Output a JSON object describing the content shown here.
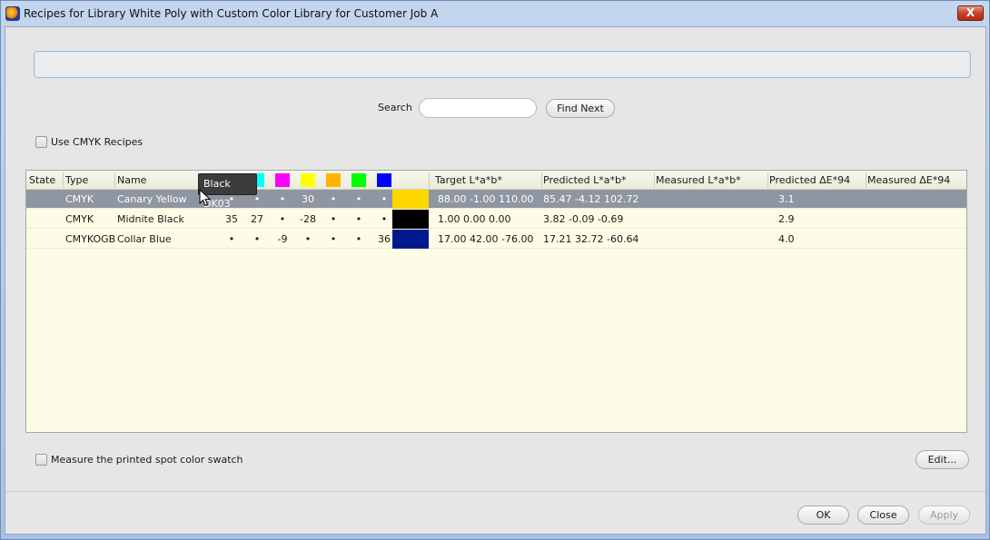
{
  "window": {
    "title": "Recipes for Library White Poly with Custom Color Library for Customer Job A",
    "close_label": "X"
  },
  "search": {
    "label": "Search",
    "value": "",
    "find_next": "Find Next"
  },
  "use_cmyk": {
    "label": "Use CMYK Recipes"
  },
  "table": {
    "headers": [
      "State",
      "Type",
      "Name",
      "Target L*a*b*",
      "Predicted L*a*b*",
      "Measured L*a*b*",
      "Predicted ΔE*94",
      "Measured ΔE*94"
    ],
    "inks": [
      {
        "name": "black-ink",
        "color": "#000000"
      },
      {
        "name": "cyan-ink",
        "color": "#00ffff"
      },
      {
        "name": "magenta-ink",
        "color": "#ff00ff"
      },
      {
        "name": "yellow-ink",
        "color": "#ffff00"
      },
      {
        "name": "orange-ink",
        "color": "#ffb400"
      },
      {
        "name": "green-ink",
        "color": "#00ff00"
      },
      {
        "name": "blue-ink",
        "color": "#0000ff"
      }
    ],
    "rows": [
      {
        "state": "",
        "type": "CMYK",
        "name": "Canary Yellow",
        "inks": [
          "•",
          "•",
          "•",
          "30",
          "•",
          "•",
          "•"
        ],
        "swatch": "#ffd700",
        "target": "88.00  -1.00  110.00",
        "predicted": "85.47  -4.12  102.72",
        "measured": "",
        "pred_de": "3.1",
        "meas_de": ""
      },
      {
        "state": "",
        "type": "CMYK",
        "name": "Midnite Black",
        "inks": [
          "35",
          "27",
          "•",
          "-28",
          "•",
          "•",
          "•"
        ],
        "swatch": "#000000",
        "target": "1.00  0.00  0.00",
        "predicted": "3.82  -0.09  -0.69",
        "measured": "",
        "pred_de": "2.9",
        "meas_de": ""
      },
      {
        "state": "",
        "type": "CMYKOGB",
        "name": "Collar Blue",
        "inks": [
          "•",
          "•",
          "-9",
          "•",
          "•",
          "•",
          "36"
        ],
        "swatch": "#001a8c",
        "target": "17.00  42.00  -76.00",
        "predicted": "17.21  32.72  -60.64",
        "measured": "",
        "pred_de": "4.0",
        "meas_de": ""
      }
    ]
  },
  "tooltip": {
    "text": "Black DK03"
  },
  "measure": {
    "label": "Measure the printed spot color swatch"
  },
  "buttons": {
    "edit": "Edit...",
    "ok": "OK",
    "close": "Close",
    "apply": "Apply"
  }
}
